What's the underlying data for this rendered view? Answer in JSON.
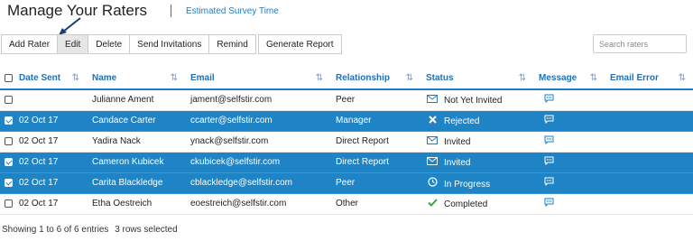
{
  "page": {
    "title": "Manage Your Raters",
    "survey_link": "Estimated Survey Time"
  },
  "toolbar": {
    "add_rater": "Add Rater",
    "edit": "Edit",
    "delete": "Delete",
    "send_invitations": "Send Invitations",
    "remind": "Remind",
    "generate_report": "Generate Report"
  },
  "search": {
    "placeholder": "Search raters",
    "value": ""
  },
  "table": {
    "columns": {
      "date_sent": "Date Sent",
      "name": "Name",
      "email": "Email",
      "relationship": "Relationship",
      "status": "Status",
      "message": "Message",
      "email_error": "Email Error"
    },
    "rows": [
      {
        "selected": false,
        "date": "",
        "name": "Julianne Ament",
        "email": "jament@selfstir.com",
        "relationship": "Peer",
        "status_icon": "envelope-icon",
        "status": "Not Yet Invited"
      },
      {
        "selected": true,
        "date": "02 Oct 17",
        "name": "Candace Carter",
        "email": "ccarter@selfstir.com",
        "relationship": "Manager",
        "status_icon": "x-icon",
        "status": "Rejected"
      },
      {
        "selected": false,
        "date": "02 Oct 17",
        "name": "Yadira Nack",
        "email": "ynack@selfstir.com",
        "relationship": "Direct Report",
        "status_icon": "envelope-icon",
        "status": "Invited"
      },
      {
        "selected": true,
        "date": "02 Oct 17",
        "name": "Cameron Kubicek",
        "email": "ckubicek@selfstir.com",
        "relationship": "Direct Report",
        "status_icon": "envelope-icon",
        "status": "Invited"
      },
      {
        "selected": true,
        "date": "02 Oct 17",
        "name": "Carita Blackledge",
        "email": "cblackledge@selfstir.com",
        "relationship": "Peer",
        "status_icon": "clock-icon",
        "status": "In Progress"
      },
      {
        "selected": false,
        "date": "02 Oct 17",
        "name": "Etha Oestreich",
        "email": "eoestreich@selfstir.com",
        "relationship": "Other",
        "status_icon": "check-icon",
        "status": "Completed"
      }
    ]
  },
  "footer": {
    "entries": "Showing 1 to 6 of 6 entries",
    "selected": "3 rows selected"
  },
  "colors": {
    "accent": "#1e7cc8",
    "selected_row": "#1e84c6",
    "check_green": "#3aa83a"
  }
}
